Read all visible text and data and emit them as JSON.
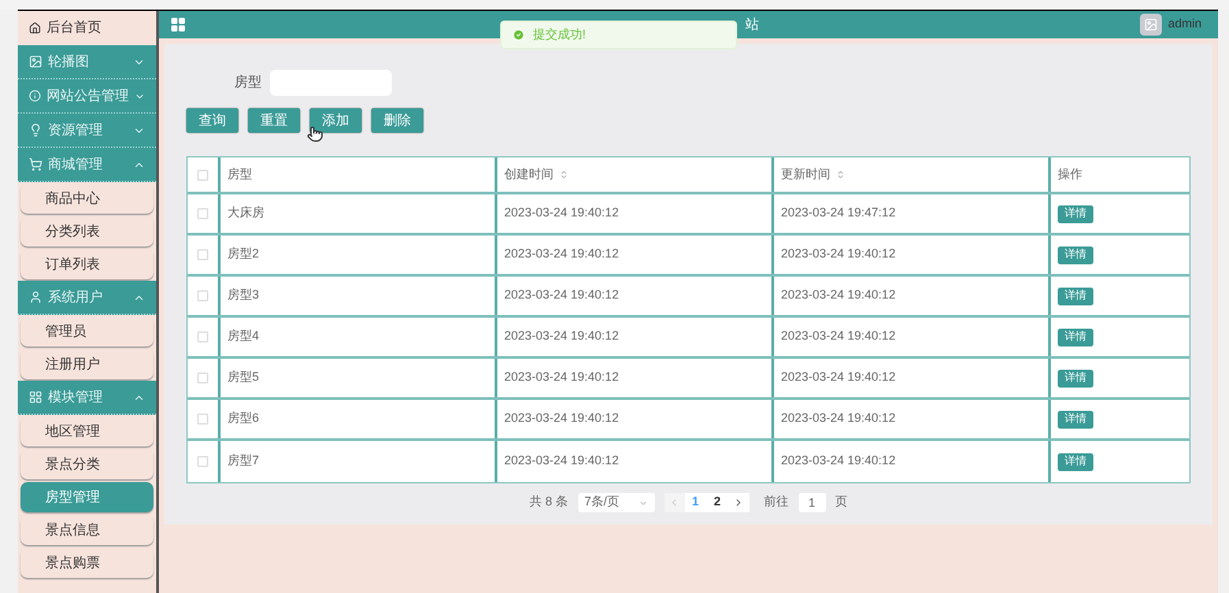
{
  "header": {
    "title": "站",
    "user": "admin"
  },
  "toast": {
    "message": "提交成功!"
  },
  "sidebar": {
    "items": [
      {
        "kind": "home",
        "label": "后台首页"
      },
      {
        "kind": "group",
        "label": "轮播图",
        "expanded": false
      },
      {
        "kind": "group",
        "label": "网站公告管理",
        "expanded": false
      },
      {
        "kind": "group",
        "label": "资源管理",
        "expanded": false
      },
      {
        "kind": "group",
        "label": "商城管理",
        "expanded": true,
        "children": [
          {
            "label": "商品中心",
            "selected": false
          },
          {
            "label": "分类列表",
            "selected": false
          },
          {
            "label": "订单列表",
            "selected": false
          }
        ]
      },
      {
        "kind": "group",
        "label": "系统用户",
        "expanded": true,
        "children": [
          {
            "label": "管理员",
            "selected": false
          },
          {
            "label": "注册用户",
            "selected": false
          }
        ]
      },
      {
        "kind": "group",
        "label": "模块管理",
        "expanded": true,
        "children": [
          {
            "label": "地区管理",
            "selected": false
          },
          {
            "label": "景点分类",
            "selected": false
          },
          {
            "label": "房型管理",
            "selected": true
          },
          {
            "label": "景点信息",
            "selected": false
          },
          {
            "label": "景点购票",
            "selected": false
          }
        ]
      }
    ]
  },
  "search": {
    "label": "房型"
  },
  "buttons": [
    "查询",
    "重置",
    "添加",
    "删除"
  ],
  "table": {
    "header_checked": false,
    "columns": [
      {
        "label": "房型",
        "sortable": false
      },
      {
        "label": "创建时间",
        "sortable": true
      },
      {
        "label": "更新时间",
        "sortable": true
      },
      {
        "label": "操作",
        "sortable": false
      }
    ],
    "rows": [
      {
        "checked": false,
        "cells": [
          "大床房",
          "2023-03-24 19:40:12",
          "2023-03-24 19:47:12"
        ],
        "action": "详情"
      },
      {
        "checked": false,
        "cells": [
          "房型2",
          "2023-03-24 19:40:12",
          "2023-03-24 19:40:12"
        ],
        "action": "详情"
      },
      {
        "checked": false,
        "cells": [
          "房型3",
          "2023-03-24 19:40:12",
          "2023-03-24 19:40:12"
        ],
        "action": "详情"
      },
      {
        "checked": false,
        "cells": [
          "房型4",
          "2023-03-24 19:40:12",
          "2023-03-24 19:40:12"
        ],
        "action": "详情"
      },
      {
        "checked": false,
        "cells": [
          "房型5",
          "2023-03-24 19:40:12",
          "2023-03-24 19:40:12"
        ],
        "action": "详情"
      },
      {
        "checked": false,
        "cells": [
          "房型6",
          "2023-03-24 19:40:12",
          "2023-03-24 19:40:12"
        ],
        "action": "详情"
      },
      {
        "checked": false,
        "cells": [
          "房型7",
          "2023-03-24 19:40:12",
          "2023-03-24 19:40:12"
        ],
        "action": "详情"
      }
    ]
  },
  "pagination": {
    "total": "共 8 条",
    "page_size": "7条/页",
    "pages": [
      {
        "label": "1",
        "selected": true
      },
      {
        "label": "2",
        "selected": false
      }
    ],
    "goto_label": "前往",
    "goto_value": "1",
    "goto_suffix": "页"
  }
}
